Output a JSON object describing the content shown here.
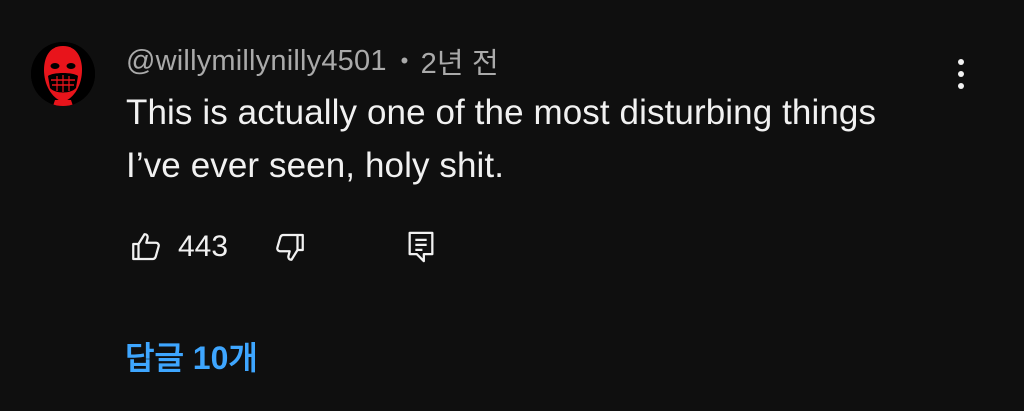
{
  "comment": {
    "author": "@willymillynilly4501",
    "separator": "•",
    "timestamp": "2년 전",
    "text_lines": [
      "This is actually one of the most disturbing things",
      "I’ve ever seen, holy shit."
    ],
    "like_count": "443",
    "replies_label": "답글 10개"
  },
  "icons": {
    "avatar": "red-masked-face-avatar",
    "more": "vertical-ellipsis-icon",
    "like": "thumbs-up-icon",
    "dislike": "thumbs-down-icon",
    "reply": "comment-reply-icon"
  },
  "colors": {
    "background": "#0f0f0f",
    "primary_text": "#f1f1f1",
    "secondary_text": "#aaaaaa",
    "link_blue": "#3ea6ff",
    "avatar_red": "#e8141b"
  }
}
